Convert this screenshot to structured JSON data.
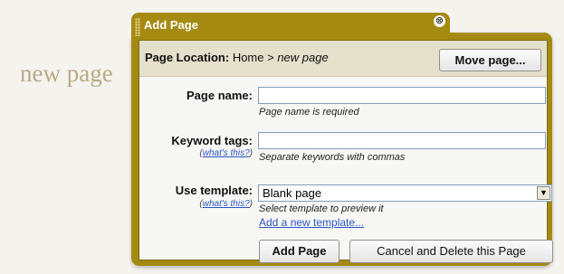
{
  "background": {
    "page_title": "new page"
  },
  "dialog": {
    "title": "Add Page",
    "close_glyph": "⊗",
    "location": {
      "label": "Page Location:",
      "path": "Home > ",
      "current": "new page"
    },
    "move_button": "Move page...",
    "fields": {
      "page_name": {
        "label": "Page name:",
        "value": "",
        "hint": "Page name is required"
      },
      "keyword_tags": {
        "label": "Keyword tags:",
        "help_link": "what's this?",
        "value": "",
        "hint": "Separate keywords with commas"
      },
      "template": {
        "label": "Use template:",
        "help_link": "what's this?",
        "selected": "Blank page",
        "hint": "Select template to preview it",
        "add_link": "Add a new template..."
      }
    },
    "buttons": {
      "add": "Add Page",
      "cancel": "Cancel and Delete this Page"
    }
  },
  "colors": {
    "frame": "#a58a12",
    "location_bar": "#e5e0cb",
    "link": "#2a56c6",
    "bg_title": "#b7ab86"
  },
  "icons": {
    "close": "close-icon",
    "dropdown": "chevron-down-icon",
    "grip": "drag-grip-icon"
  }
}
